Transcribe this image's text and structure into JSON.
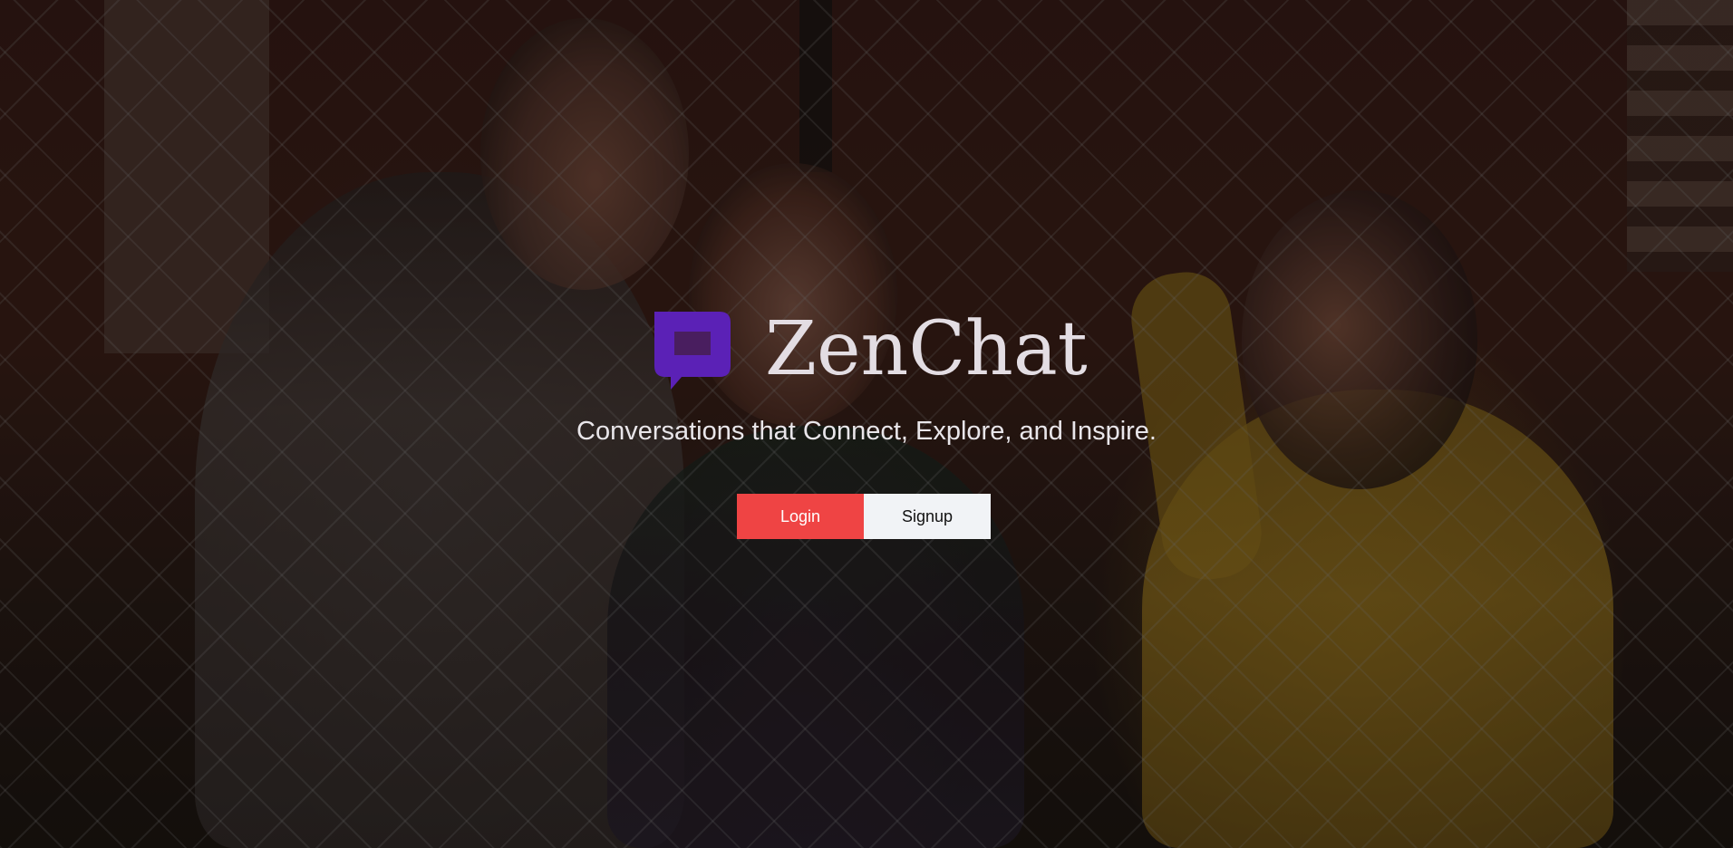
{
  "brand": {
    "name": "ZenChat",
    "logo_icon": "chat-bubble-icon",
    "accent": "#5b21b6"
  },
  "hero": {
    "tagline": "Conversations that Connect, Explore, and Inspire.",
    "background": "photo of three friends by a chain-link fence, darkened overlay"
  },
  "actions": {
    "login_label": "Login",
    "signup_label": "Signup",
    "login_color": "#ef4444",
    "signup_color": "#f1f3f6"
  }
}
